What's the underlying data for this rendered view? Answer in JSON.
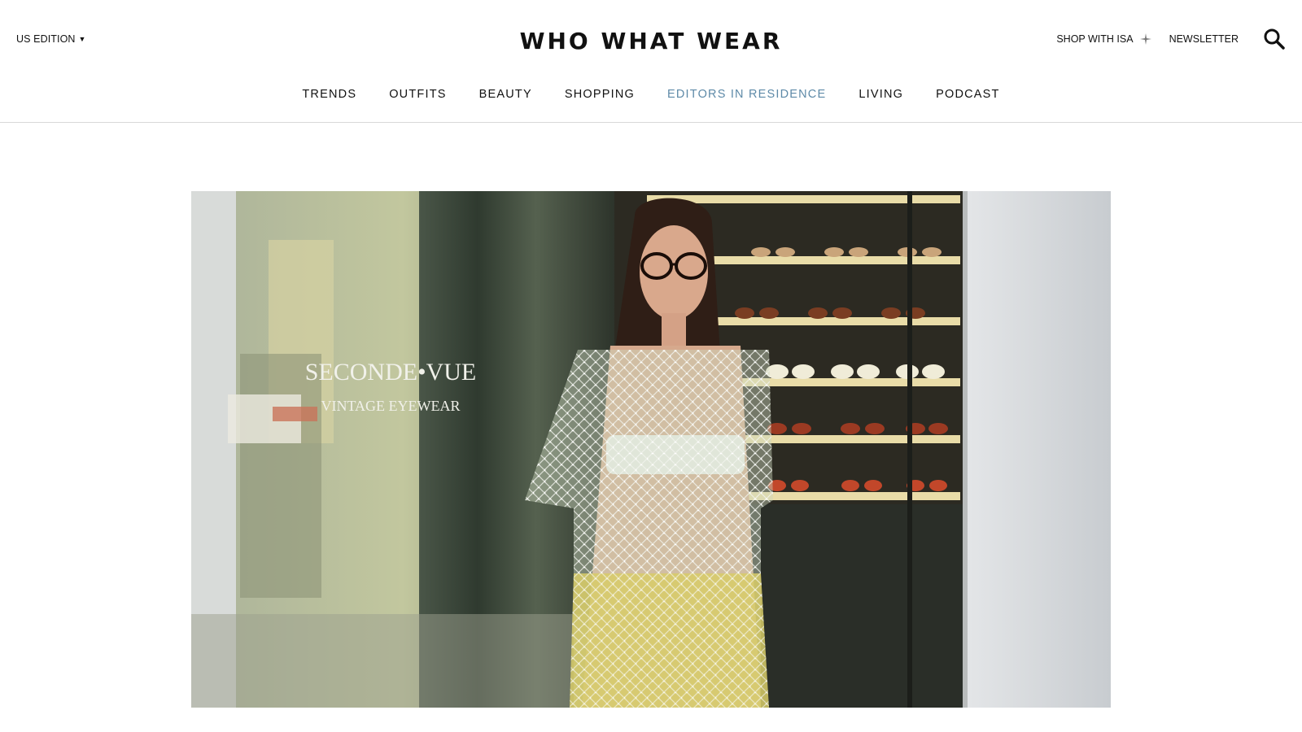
{
  "header": {
    "edition_label": "US EDITION",
    "logo": "WHO WHAT WEAR",
    "shop_label": "SHOP WITH ISA",
    "newsletter_label": "NEWSLETTER"
  },
  "nav": {
    "items": [
      {
        "label": "TRENDS"
      },
      {
        "label": "OUTFITS"
      },
      {
        "label": "BEAUTY"
      },
      {
        "label": "SHOPPING"
      },
      {
        "label": "EDITORS IN RESIDENCE"
      },
      {
        "label": "LIVING"
      },
      {
        "label": "PODCAST"
      }
    ],
    "accent_color": "#5e8aa8"
  },
  "hero": {
    "shop_sign_line1": "SECONDE•VUE",
    "shop_sign_line2": "VINTAGE EYEWEAR"
  },
  "icons": {
    "edition_caret": "caret-down-icon",
    "shop": "sparkle-icon",
    "search": "search-icon"
  }
}
